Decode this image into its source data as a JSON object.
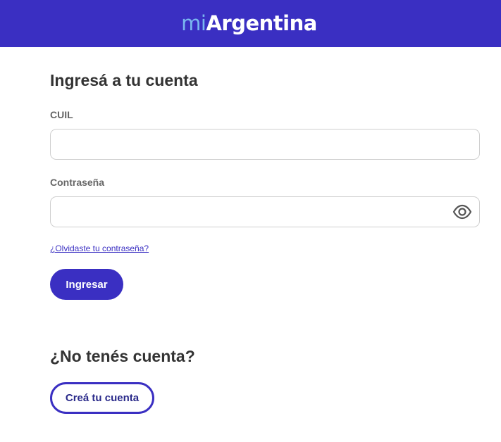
{
  "header": {
    "logo_prefix": "mi",
    "logo_main": "Argentina"
  },
  "login": {
    "title": "Ingresá a tu cuenta",
    "cuil_label": "CUIL",
    "cuil_value": "",
    "password_label": "Contraseña",
    "password_value": "",
    "show_password_icon": "eye-icon",
    "forgot_link": "¿Olvidaste tu contraseña?",
    "submit_label": "Ingresar"
  },
  "signup": {
    "title": "¿No tenés cuenta?",
    "create_label": "Creá tu cuenta"
  },
  "colors": {
    "brand": "#3a2fc2",
    "logo_accent": "#7ab8ef",
    "heading": "#333333",
    "label": "#666666"
  }
}
